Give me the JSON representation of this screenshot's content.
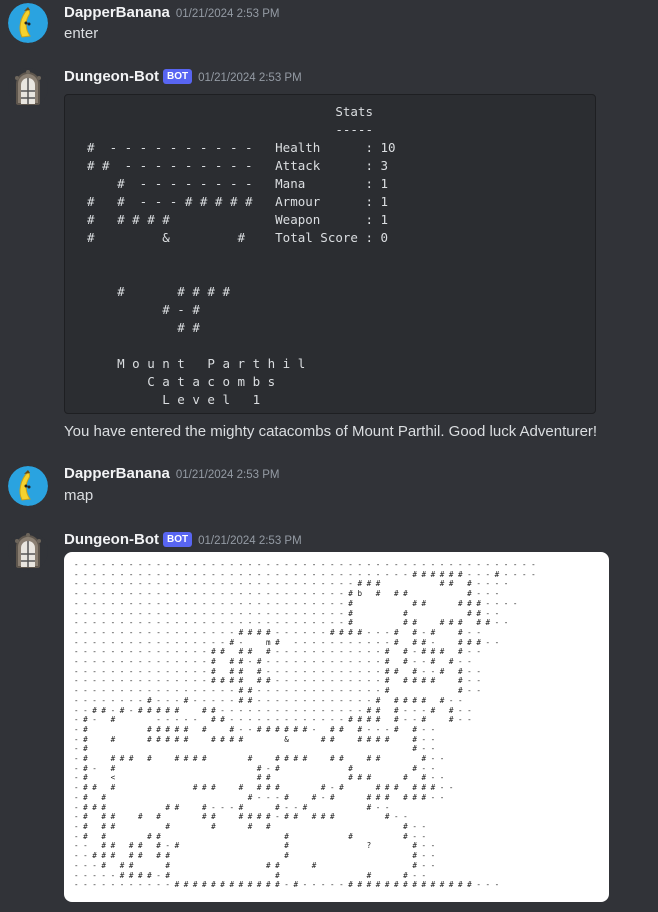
{
  "messages": [
    {
      "username": "DapperBanana",
      "timestamp": "01/21/2024 2:53 PM",
      "text": "enter",
      "avatar_icon": "banana-icon"
    },
    {
      "username": "Dungeon-Bot",
      "badge": "BOT",
      "timestamp": "01/21/2024 2:53 PM",
      "avatar_icon": "dungeon-door-icon",
      "code": "                                 Stats\n                                 -----\n#  - - - - - - - - - -   Health      : 10\n# #  - - - - - - - - -   Attack      : 3\n    #  - - - - - - - -   Mana        : 1\n#   #  - - - # # # # #   Armour      : 1\n#   # # # #              Weapon      : 1\n#         &         #    Total Score : 0\n\n\n    #       # # # #\n          # - #\n            # #\n\n    M o u n t   P a r t h i l\n        C a t a c o m b s\n          L e v e l   1",
      "text": "You have entered the mighty catacombs of Mount Parthil. Good luck Adventurer!"
    },
    {
      "username": "DapperBanana",
      "timestamp": "01/21/2024 2:53 PM",
      "text": "map",
      "avatar_icon": "banana-icon"
    },
    {
      "username": "Dungeon-Bot",
      "badge": "BOT",
      "timestamp": "01/21/2024 2:53 PM",
      "avatar_icon": "dungeon-door-icon",
      "map": "- - - - - - - - - - - - - - - - - - - - - - - - - - - - - - - - - - - - - - - - - - - - - - - - - - -\n- - - - - - - - - - - - - - - - - - - - - - - - - - - - - - - - - - - - - # # # # # # - - - # - - - -\n- - - - - - - - - - - - - - - - - - - - - - - - - - - - - - - # # #             # #   # - - - -\n- - - - - - - - - - - - - - - - - - - - - - - - - - - - - - # b   #   # #             # - - -\n- - - - - - - - - - - - - - - - - - - - - - - - - - - - - - #             # #       # # # - - - -\n- - - - - - - - - - - - - - - - - - - - - - - - - - - - - - #           #             # # - -\n- - - - - - - - - - - - - - - - - - - - - - - - - - - - - - #           # #     # # #   # # - -\n- - - - - - - - - - - - - - - - - - # # # # - - - - - - # # # # - - - #   # - #     # - -\n- - - - - - - - - - - - - - - - - # -     m #   - - - - - - - - - - - #   # # -     # # # - -\n- - - - - - - - - - - - - - - # #   # #   # - - - - - - - - - - - - #   # - # # #   # - -\n- - - - - - - - - - - - - - - #   # # - # - - - - - - - - - - - - - #   # - - #   # - -\n- - - - - - - - - - - - - - - #   # #   # - - - - - - - - - - - - - # #   # - - #   # - -\n- - - - - - - - - - - - - - - # # # #   # # - - - - - - - - - - - - #   # # # #     # - -\n- - - - - - - - - - - - - - - - - - # # - - - - - - - - - - - - - - #               # - -\n- - - - - - - - # - - - # - - - - - # # - - - - - - - - - - - - - #   # # # #   # - -\n- - # # - # - # # # # #     # # - - - - - - - - - - - - - - - - # #   # - - - #   # - -\n- # -   #         - - - - -   # # - - - - - - - - - - - - - # # # #   # - - #     # - -\n- #             # # # # #   #     # - - # # # # # # -   # #   # - - - #   # - -\n- #     #       # # # # #     # # # #         &       # #     # # # #     # - -\n- #                                                                       # - -\n- #     # # #   #     # # # #         #     # # # #     # #     # #         # - -\n- # -   #                               # - #               #             # - -\n- #     <                               # #                 # # #       #   # - -\n- # #   #                 # # #     #   # # #         # - #       # # #   # # # - -\n- #   #                               # - - - #     # - #       # # #   # # # - -\n- # # #             # #     # - - - #       # - - #             # - -\n- #   # #     #   #         # #     # # # # - # #   # # #           # - -\n- #   # #           #         #       #   #                             # - -\n- #   #         # #                           #             #           # - -\n- -   # #   # #   # - #                       #                 ?         # - -\n- - # # #   # #   # #                         #                           # - -\n- - - #   # #       #                     # #       #                     # - -\n- - - - - # # # # - #                       #                   #       # - -\n- - - - - - - - - - - # # # # # # # # # # # # - # - - - - - # # # # # # # # # # # # # # - - -"
    }
  ]
}
